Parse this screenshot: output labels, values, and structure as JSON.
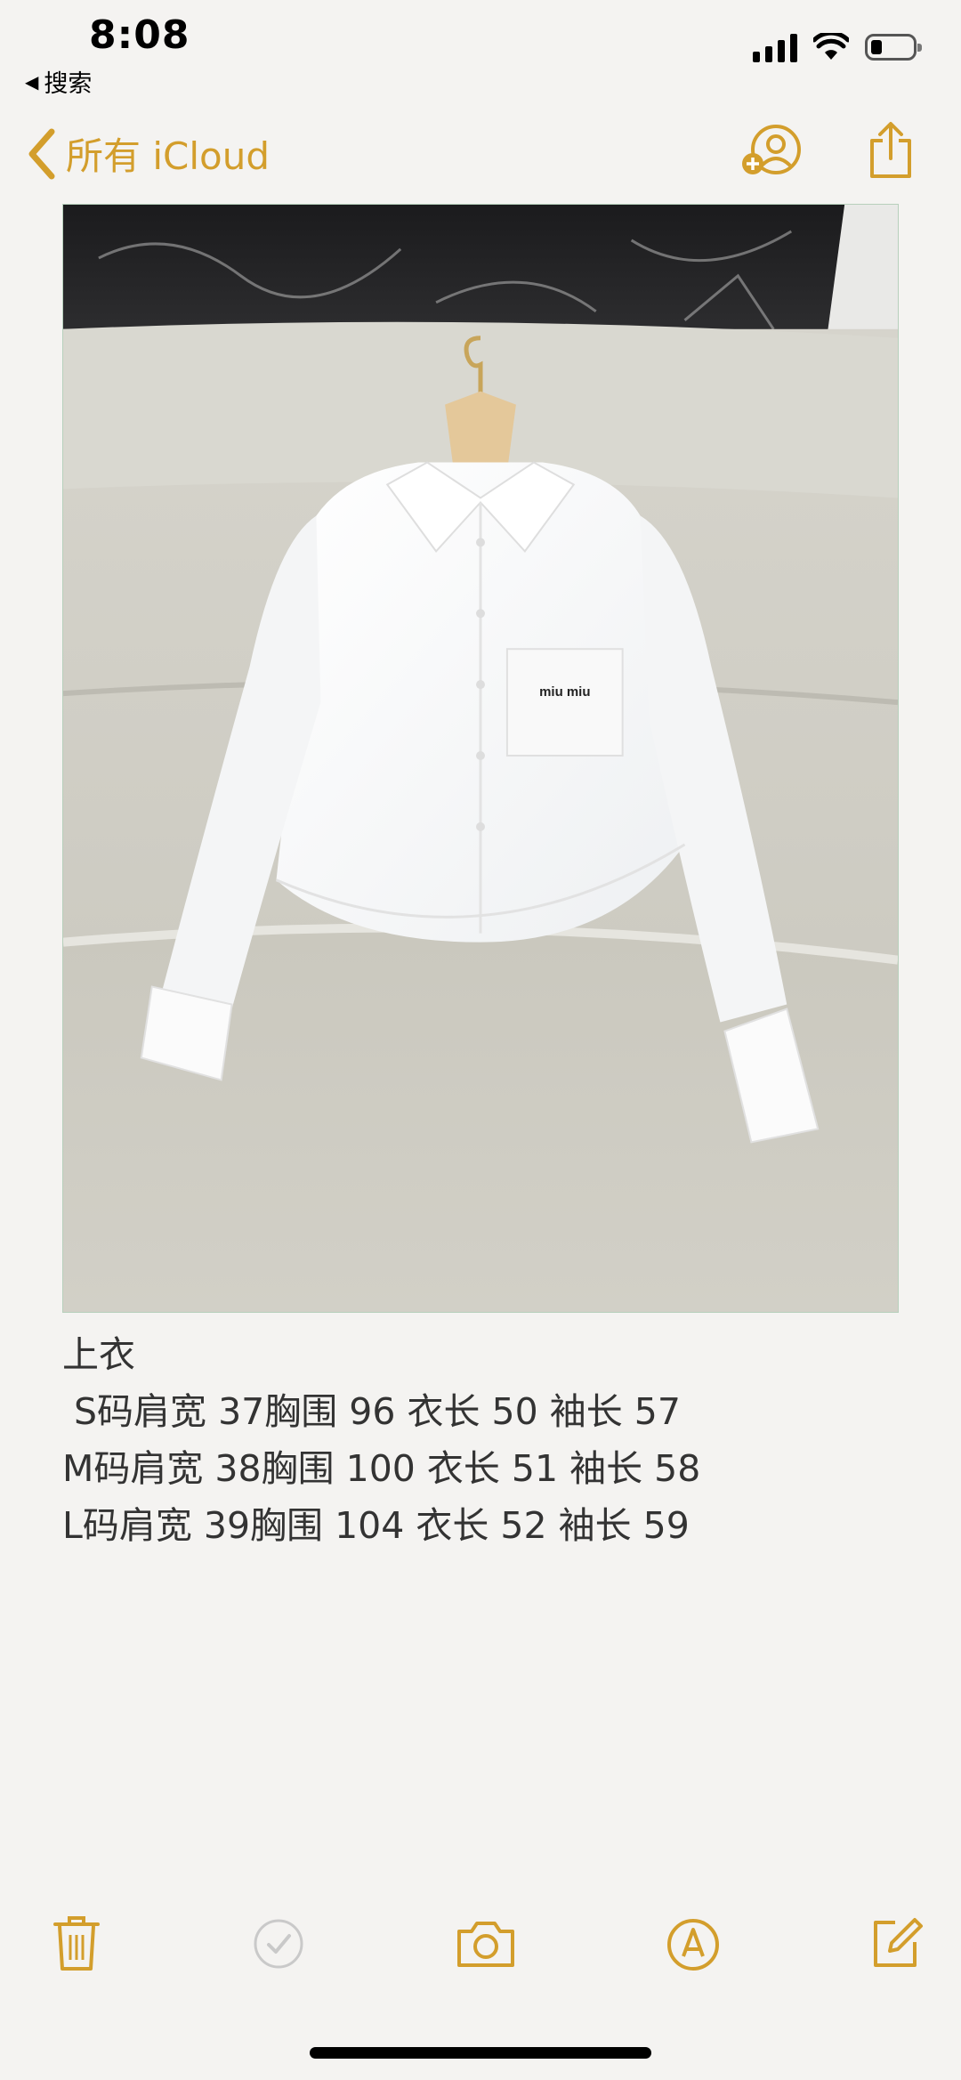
{
  "status": {
    "time": "8:08",
    "back_app": "搜索"
  },
  "nav": {
    "back_label": "所有 iCloud",
    "add_people_icon": "person-add-icon",
    "share_icon": "share-icon"
  },
  "image": {
    "description_icon": "photo-attachment"
  },
  "note": {
    "lines": [
      "上衣",
      " S码肩宽 37胸围 96 衣长 50 袖长 57",
      "M码肩宽 38胸围 100 衣长 51 袖长 58",
      "L码肩宽 39胸围 104 衣长 52 袖长 59"
    ]
  },
  "toolbar": {
    "icons": [
      "trash-icon",
      "checklist-icon",
      "camera-icon",
      "markup-icon",
      "compose-icon"
    ]
  },
  "colors": {
    "accent": "#d39e2c",
    "background": "#f4f3f1"
  }
}
